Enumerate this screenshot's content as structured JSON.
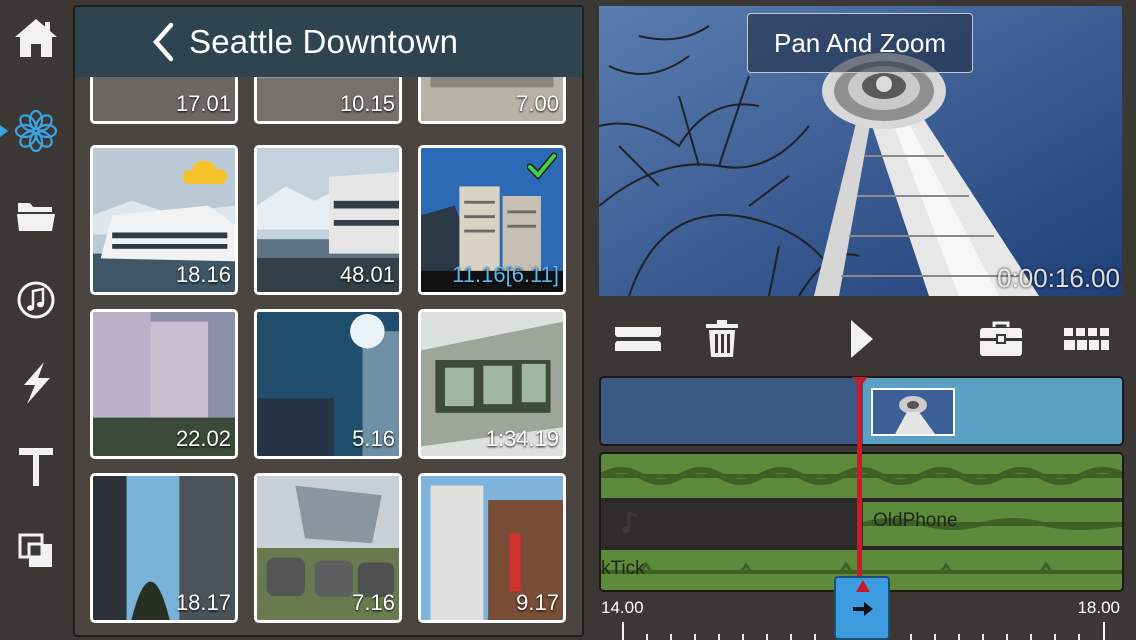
{
  "rail": {
    "items": [
      {
        "name": "home-icon"
      },
      {
        "name": "effects-icon",
        "selected": true
      },
      {
        "name": "folder-icon"
      },
      {
        "name": "music-icon"
      },
      {
        "name": "lightning-icon"
      },
      {
        "name": "text-icon"
      },
      {
        "name": "overlay-icon"
      }
    ]
  },
  "browser": {
    "title": "Seattle Downtown",
    "tiles": [
      {
        "duration": "17.01",
        "badge": null
      },
      {
        "duration": "10.15",
        "badge": null
      },
      {
        "duration": "7.00",
        "badge": null
      },
      {
        "duration": "18.16",
        "badge": "cloud-icon"
      },
      {
        "duration": "48.01",
        "badge": null
      },
      {
        "duration": "11.16[6.11]",
        "badge": "checkmark-icon",
        "selected": true
      },
      {
        "duration": "22.02",
        "badge": null
      },
      {
        "duration": "5.16",
        "badge": null
      },
      {
        "duration": "1:34.19",
        "badge": null
      },
      {
        "duration": "18.17",
        "badge": null
      },
      {
        "duration": "7.16",
        "badge": null
      },
      {
        "duration": "9.17",
        "badge": null
      }
    ]
  },
  "preview": {
    "effect_label": "Pan And Zoom",
    "timecode": "0:00:16.00"
  },
  "toolbar": {
    "buttons": [
      "split-clip-icon",
      "trash-icon",
      "play-icon",
      "toolbox-icon",
      "storyboard-icon"
    ]
  },
  "timeline": {
    "audio_labels": {
      "lane2": "OldPhone",
      "lane3": "kTick"
    },
    "ruler": {
      "start": "14.00",
      "end": "18.00"
    },
    "colors": {
      "video": "#3a5a85",
      "video_clip": "#5a9fc4",
      "audio": "#5e8a3c",
      "playhead": "#c41e2a",
      "handle": "#3d9ce0"
    }
  }
}
